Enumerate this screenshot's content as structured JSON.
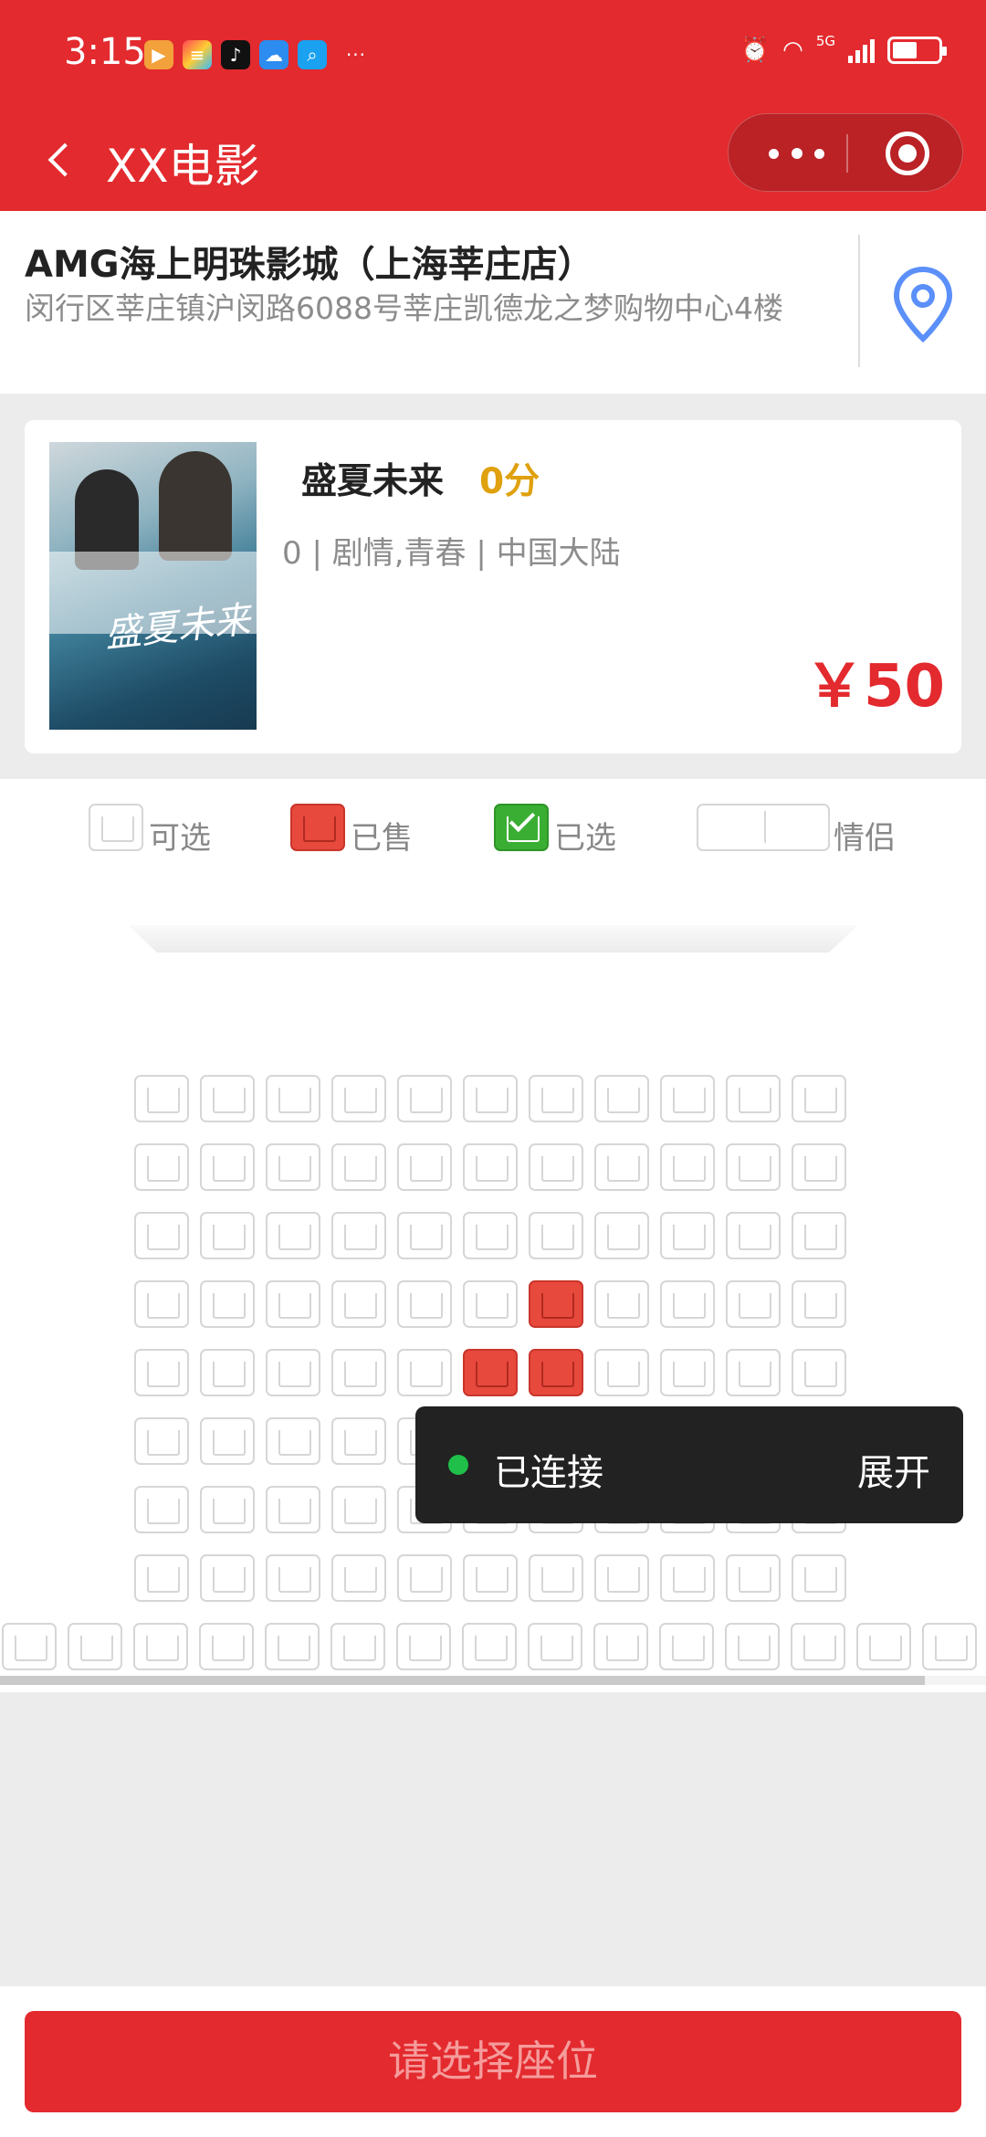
{
  "status_bar": {
    "time": "3:15",
    "more": "···",
    "network": "5G"
  },
  "nav": {
    "title": "XX电影"
  },
  "cinema": {
    "name": "AMG海上明珠影城（上海莘庄店）",
    "address": "闵行区莘庄镇沪闵路6088号莘庄凯德龙之梦购物中心4楼"
  },
  "movie": {
    "title": "盛夏未来",
    "score": "0分",
    "meta": "0 | 剧情,青春 | 中国大陆",
    "price": "￥50",
    "poster_text": "盛夏未来"
  },
  "legend": {
    "available": "可选",
    "sold": "已售",
    "selected": "已选",
    "couple": "情侣"
  },
  "seat_map": {
    "rows": [
      {
        "count": 11,
        "sold": []
      },
      {
        "count": 11,
        "sold": []
      },
      {
        "count": 11,
        "sold": []
      },
      {
        "count": 11,
        "sold": [
          6
        ]
      },
      {
        "count": 11,
        "sold": [
          5,
          6
        ]
      },
      {
        "count": 11,
        "sold": []
      },
      {
        "count": 11,
        "sold": []
      },
      {
        "count": 11,
        "sold": []
      },
      {
        "count": 15,
        "sold": []
      }
    ]
  },
  "toast": {
    "text": "已连接",
    "action": "展开"
  },
  "bottom": {
    "button_label": "请选择座位"
  },
  "colors": {
    "primary": "#e32a2e",
    "score": "#e0a10f",
    "sold": "#e8493d",
    "selected": "#3aae33",
    "location": "#5b8ff9"
  }
}
